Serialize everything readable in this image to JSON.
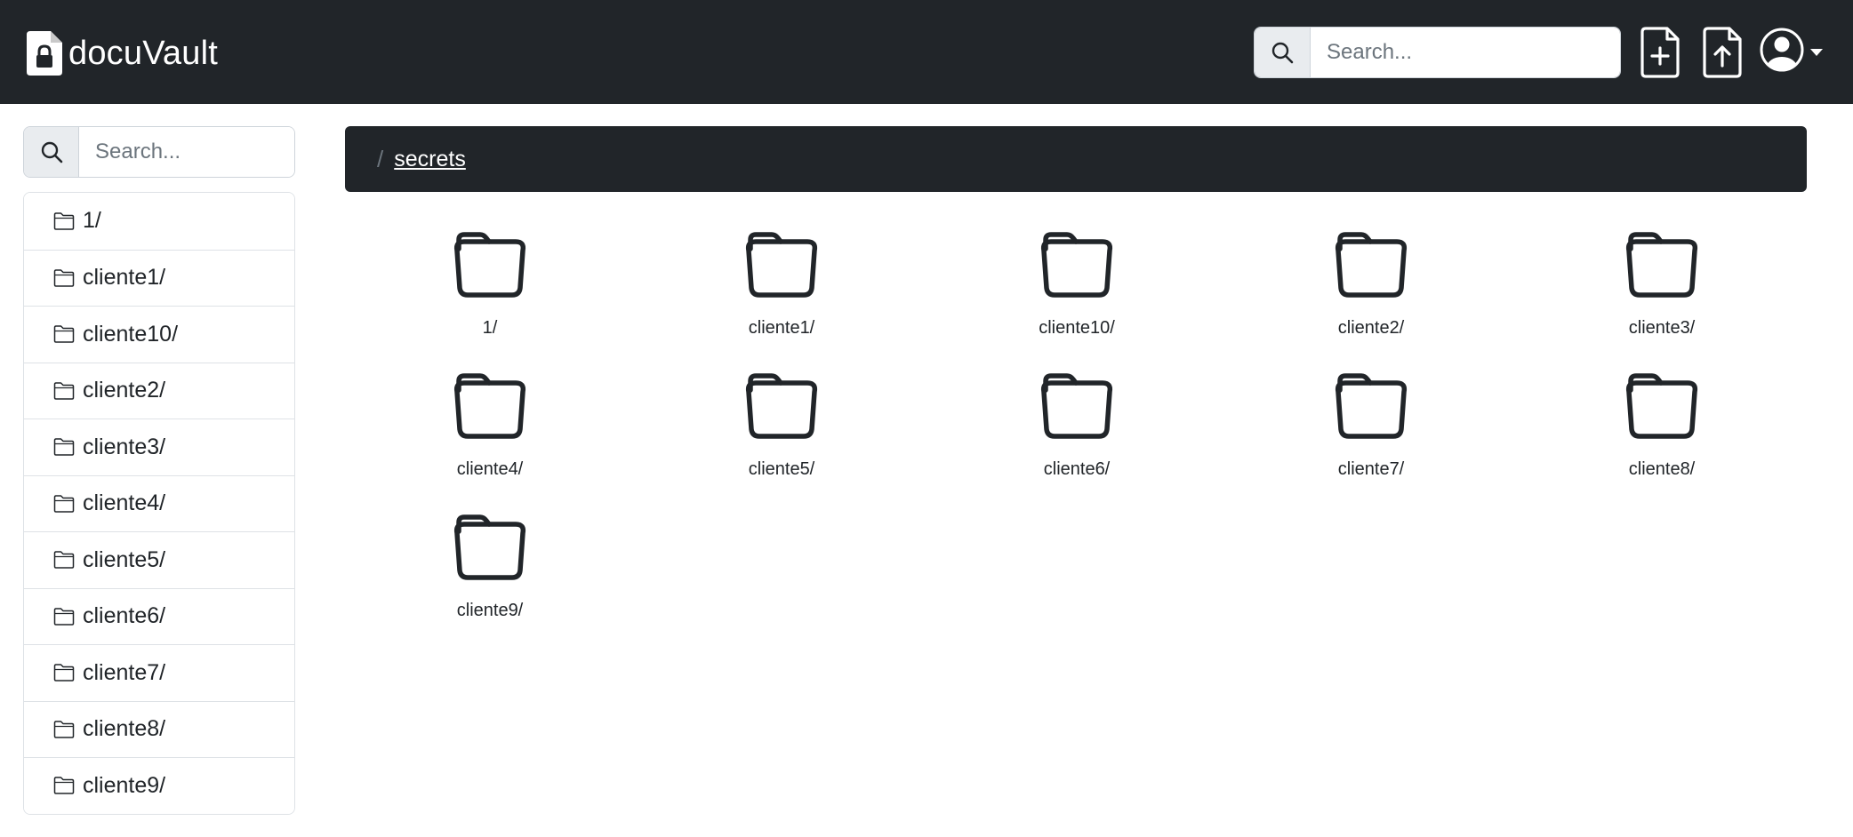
{
  "app": {
    "name": "docuVault"
  },
  "header": {
    "search_placeholder": "Search...",
    "icons": [
      "search-icon",
      "file-plus-icon",
      "file-upload-icon",
      "user-circle-icon",
      "caret-down-icon"
    ]
  },
  "sidebar": {
    "search_placeholder": "Search...",
    "items": [
      {
        "label": "1/"
      },
      {
        "label": "cliente1/"
      },
      {
        "label": "cliente10/"
      },
      {
        "label": "cliente2/"
      },
      {
        "label": "cliente3/"
      },
      {
        "label": "cliente4/"
      },
      {
        "label": "cliente5/"
      },
      {
        "label": "cliente6/"
      },
      {
        "label": "cliente7/"
      },
      {
        "label": "cliente8/"
      },
      {
        "label": "cliente9/"
      }
    ]
  },
  "breadcrumb": {
    "separator": "/",
    "current": "secrets"
  },
  "folders": [
    {
      "label": "1/"
    },
    {
      "label": "cliente1/"
    },
    {
      "label": "cliente10/"
    },
    {
      "label": "cliente2/"
    },
    {
      "label": "cliente3/"
    },
    {
      "label": "cliente4/"
    },
    {
      "label": "cliente5/"
    },
    {
      "label": "cliente6/"
    },
    {
      "label": "cliente7/"
    },
    {
      "label": "cliente8/"
    },
    {
      "label": "cliente9/"
    }
  ],
  "colors": {
    "navbar": "#212529",
    "text": "#212529",
    "border": "#dee2e6",
    "addon": "#e9ecef"
  }
}
